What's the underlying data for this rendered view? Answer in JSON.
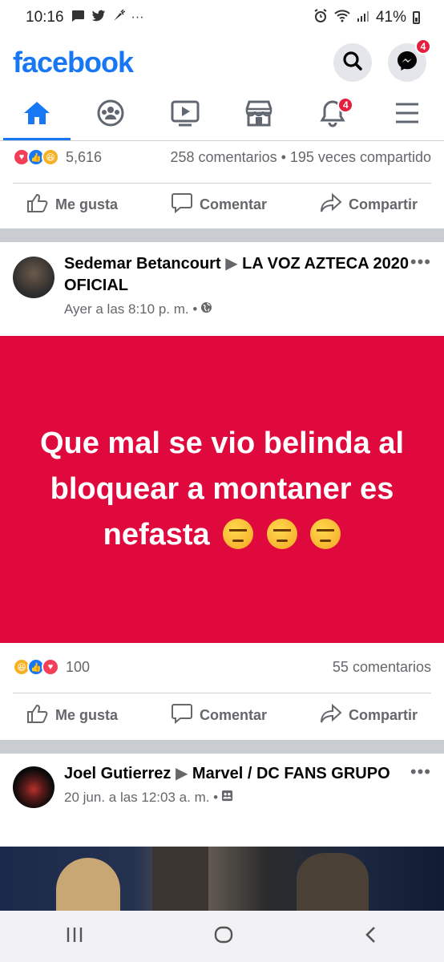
{
  "status_bar": {
    "time": "10:16",
    "more": "···",
    "battery": "41%"
  },
  "header": {
    "logo": "facebook",
    "messenger_badge": "4"
  },
  "nav": {
    "notifications_badge": "4"
  },
  "prev_post": {
    "reactions_count": "5,616",
    "stats": "258 comentarios • 195 veces compartido",
    "actions": {
      "like": "Me gusta",
      "comment": "Comentar",
      "share": "Compartir"
    }
  },
  "post1": {
    "author": "Sedemar Betancourt",
    "group": "LA VOZ AZTECA 2020 OFICIAL",
    "time": "Ayer a las 8:10 p. m. •",
    "status_text": "Que mal se vio belinda al bloquear a montaner es nefasta",
    "reactions_count": "100",
    "comments": "55 comentarios",
    "actions": {
      "like": "Me gusta",
      "comment": "Comentar",
      "share": "Compartir"
    }
  },
  "post2": {
    "author": "Joel Gutierrez",
    "group": "Marvel / DC FANS GRUPO",
    "time": "20 jun. a las 12:03 a. m. •"
  },
  "colors": {
    "brand": "#1877f2",
    "status_bg": "#e0093d",
    "badge": "#e41e3f"
  },
  "icons": [
    "home-icon",
    "groups-icon",
    "watch-icon",
    "marketplace-icon",
    "bell-icon",
    "menu-icon",
    "search-icon",
    "messenger-icon",
    "globe-icon",
    "like-icon",
    "comment-icon",
    "share-icon",
    "recents-icon",
    "home-nav-icon",
    "back-icon"
  ]
}
